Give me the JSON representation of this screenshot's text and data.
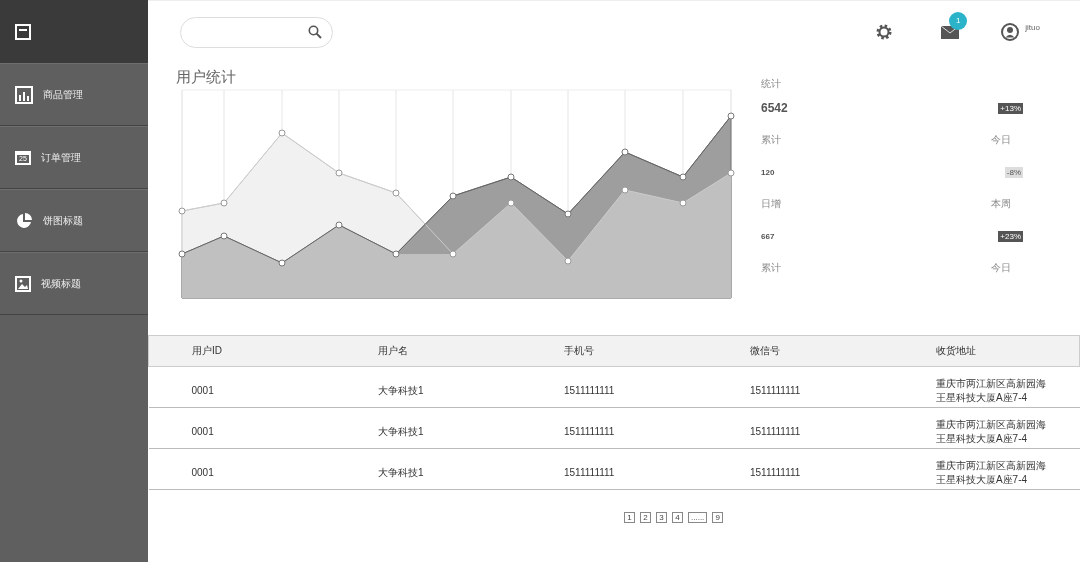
{
  "sidebar": {
    "items": [
      {
        "label": "商品管理",
        "kind": "bars"
      },
      {
        "label": "订单管理",
        "kind": "calendar",
        "icon_text": "25"
      },
      {
        "label": "饼图标题",
        "kind": "pie"
      },
      {
        "label": "视频标题",
        "kind": "image"
      }
    ]
  },
  "header": {
    "notification_count": "1",
    "user": "jituo"
  },
  "stats": {
    "title": "用户统计",
    "heading": "统计",
    "total": "6542",
    "total_change": "+13%",
    "rows": [
      {
        "caption": "累计",
        "period": "今日",
        "value": "120",
        "change": "-8%",
        "muted": true
      },
      {
        "caption": "日增",
        "period": "本周",
        "value": "667",
        "change": "+23%",
        "muted": false
      }
    ],
    "last_caption": "累计",
    "last_period": "今日"
  },
  "table": {
    "columns": [
      "用户ID",
      "用户名",
      "手机号",
      "微信号",
      "收货地址"
    ],
    "rows": [
      [
        "0001",
        "大争科技1",
        "1511111111",
        "1511111111",
        "重庆市两江新区高新园海王星科技大厦A座7-4"
      ],
      [
        "0001",
        "大争科技1",
        "1511111111",
        "1511111111",
        "重庆市两江新区高新园海王星科技大厦A座7-4"
      ],
      [
        "0001",
        "大争科技1",
        "1511111111",
        "1511111111",
        "重庆市两江新区高新园海王星科技大厦A座7-4"
      ]
    ]
  },
  "pagination": {
    "pages": [
      "1",
      "2",
      "3",
      "4",
      "......",
      "9"
    ]
  }
}
